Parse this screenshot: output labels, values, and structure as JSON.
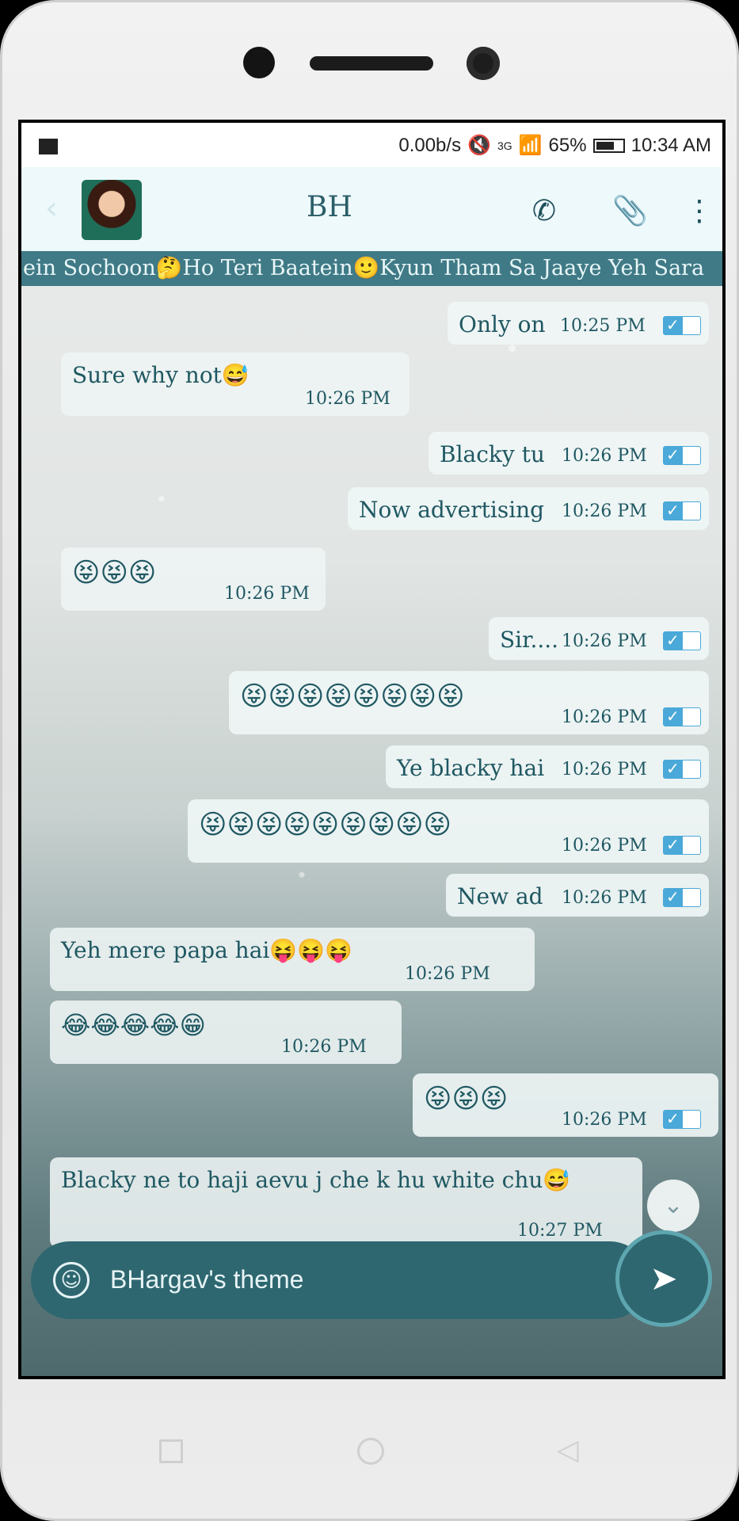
{
  "status": {
    "speed": "0.00b/s",
    "network": "3G",
    "battery_pct": "65%",
    "time": "10:34 AM"
  },
  "header": {
    "contact_name": "BH",
    "icons": [
      "back-arrow-icon",
      "phone-icon",
      "paperclip-icon",
      "more-vert-icon"
    ]
  },
  "marquee": "ein Sochoon🤔Ho Teri Baatein🙂Kyun Tham Sa Jaaye Yeh Sara",
  "messages": [
    {
      "dir": "out",
      "text": "Only on",
      "time": "10:25 PM",
      "read": true
    },
    {
      "dir": "in",
      "text": "Sure why not😅",
      "time": "10:26 PM"
    },
    {
      "dir": "out",
      "text": "Blacky tu",
      "time": "10:26 PM",
      "read": true
    },
    {
      "dir": "out",
      "text": "Now advertising",
      "time": "10:26 PM",
      "read": true
    },
    {
      "dir": "in",
      "text": "😝😝😝",
      "time": "10:26 PM"
    },
    {
      "dir": "out",
      "text": "Sir....",
      "time": "10:26 PM",
      "read": true
    },
    {
      "dir": "out",
      "text": "😝😝😝😝😝😝😝😝",
      "time": "10:26 PM",
      "read": true
    },
    {
      "dir": "out",
      "text": "Ye blacky hai",
      "time": "10:26 PM",
      "read": true
    },
    {
      "dir": "out",
      "text": "😝😝😝😝😝😝😝😝😝",
      "time": "10:26 PM",
      "read": true
    },
    {
      "dir": "out",
      "text": "New ad",
      "time": "10:26 PM",
      "read": true
    },
    {
      "dir": "in",
      "text": "Yeh mere papa hai😝😝😝",
      "time": "10:26 PM"
    },
    {
      "dir": "in",
      "text": "😂😂😂😂😁",
      "time": "10:26 PM"
    },
    {
      "dir": "out",
      "text": "😝😝😝",
      "time": "10:26 PM",
      "read": true
    },
    {
      "dir": "in",
      "text": "Blacky ne to haji aevu j che k hu white chu😅",
      "time": "10:27 PM"
    }
  ],
  "input": {
    "value": "BHargav's theme"
  },
  "colors": {
    "appbar": "#eef9fb",
    "marquee_bg": "#3f7a86",
    "text_teal": "#1f5862",
    "input_bg": "#2e6770",
    "tick_blue": "#4aa9d8"
  }
}
